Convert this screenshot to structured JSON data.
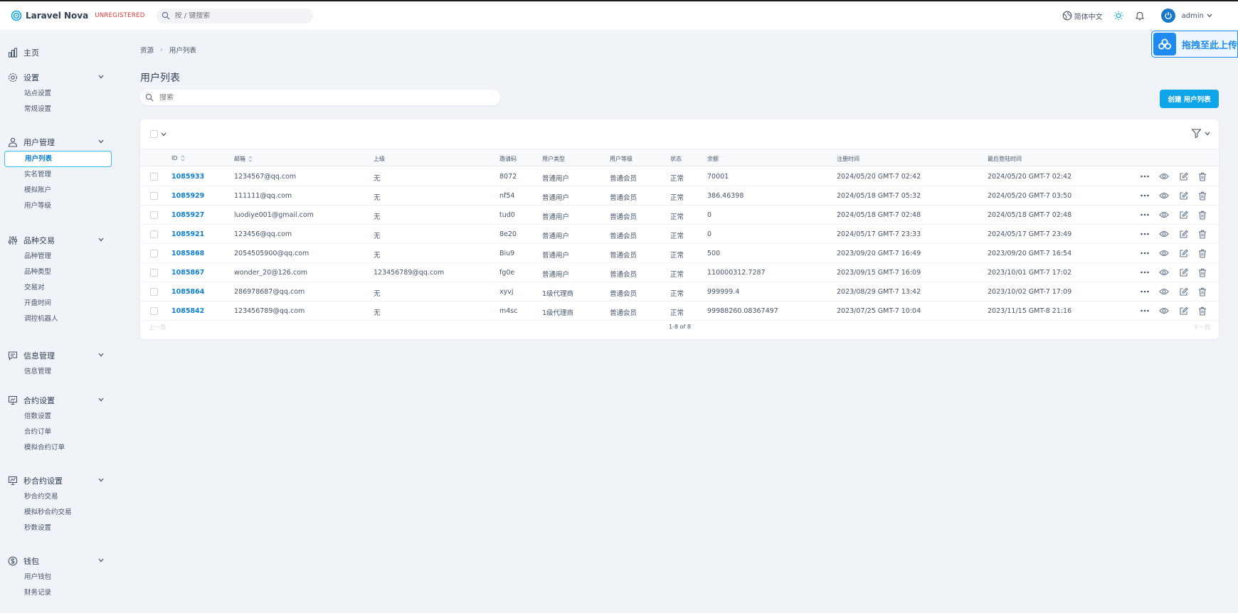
{
  "app": {
    "brand": "Laravel Nova",
    "unregistered": "UNREGISTERED"
  },
  "topbar": {
    "search_placeholder": "按 / 键搜索",
    "language": "简体中文",
    "user": "admin"
  },
  "upload": {
    "label": "拖拽至此上传"
  },
  "sidebar": {
    "home": "主页",
    "groups": [
      {
        "label": "设置",
        "items": [
          "站点设置",
          "常规设置"
        ]
      },
      {
        "label": "用户管理",
        "items": [
          "用户列表",
          "实名管理",
          "模拟账户",
          "用户等级"
        ]
      },
      {
        "label": "品种交易",
        "items": [
          "品种管理",
          "品种类型",
          "交易对",
          "开盘时间",
          "调控机器人"
        ]
      },
      {
        "label": "信息管理",
        "items": [
          "信息管理"
        ]
      },
      {
        "label": "合约设置",
        "items": [
          "倍数设置",
          "合约订单",
          "模拟合约订单"
        ]
      },
      {
        "label": "秒合约设置",
        "items": [
          "秒合约交易",
          "模拟秒合约交易",
          "秒数设置"
        ]
      },
      {
        "label": "钱包",
        "items": [
          "用户钱包",
          "财务记录"
        ]
      }
    ]
  },
  "breadcrumb": {
    "root": "资源",
    "current": "用户列表"
  },
  "page": {
    "title": "用户列表",
    "search_placeholder": "搜索",
    "create_button": "创建 用户列表"
  },
  "table": {
    "columns": [
      "ID",
      "邮箱",
      "上级",
      "邀请码",
      "用户类型",
      "用户等级",
      "状态",
      "余额",
      "注册时间",
      "最后登陆时间"
    ],
    "rows": [
      [
        "1085933",
        "1234567@qq.com",
        "无",
        "8072",
        "普通用户",
        "普通会员",
        "正常",
        "70001",
        "2024/05/20 GMT-7 02:42",
        "2024/05/20 GMT-7 02:42"
      ],
      [
        "1085929",
        "111111@qq.com",
        "无",
        "nf54",
        "普通用户",
        "普通会员",
        "正常",
        "386.46398",
        "2024/05/18 GMT-7 05:32",
        "2024/05/20 GMT-7 03:50"
      ],
      [
        "1085927",
        "luodiye001@gmail.com",
        "无",
        "tud0",
        "普通用户",
        "普通会员",
        "正常",
        "0",
        "2024/05/18 GMT-7 02:48",
        "2024/05/18 GMT-7 02:48"
      ],
      [
        "1085921",
        "123456@qq.com",
        "无",
        "8e20",
        "普通用户",
        "普通会员",
        "正常",
        "0",
        "2024/05/17 GMT-7 23:33",
        "2024/05/17 GMT-7 23:49"
      ],
      [
        "1085868",
        "2054505900@qq.com",
        "无",
        "Biu9",
        "普通用户",
        "普通会员",
        "正常",
        "500",
        "2023/09/20 GMT-7 16:49",
        "2023/09/20 GMT-7 16:54"
      ],
      [
        "1085867",
        "wonder_20@126.com",
        "123456789@qq.com",
        "fg0e",
        "普通用户",
        "普通会员",
        "正常",
        "110000312.7287",
        "2023/09/15 GMT-7 16:09",
        "2023/10/01 GMT-7 17:02"
      ],
      [
        "1085864",
        "286978687@qq.com",
        "无",
        "xyvj",
        "1级代理商",
        "普通会员",
        "正常",
        "999999.4",
        "2023/08/29 GMT-7 13:42",
        "2023/10/02 GMT-7 17:09"
      ],
      [
        "1085842",
        "123456789@qq.com",
        "无",
        "m4sc",
        "1级代理商",
        "普通会员",
        "正常",
        "99988260.08367497",
        "2023/07/25 GMT-7 10:04",
        "2023/11/15 GMT-8 21:16"
      ]
    ]
  },
  "pagination": {
    "prev": "上一页",
    "count": "1-8 of 8",
    "next": "下一页"
  },
  "colors": {
    "accent": "#0ea5e9",
    "link": "#0e7fd1",
    "upload": "#1f8bf0"
  }
}
